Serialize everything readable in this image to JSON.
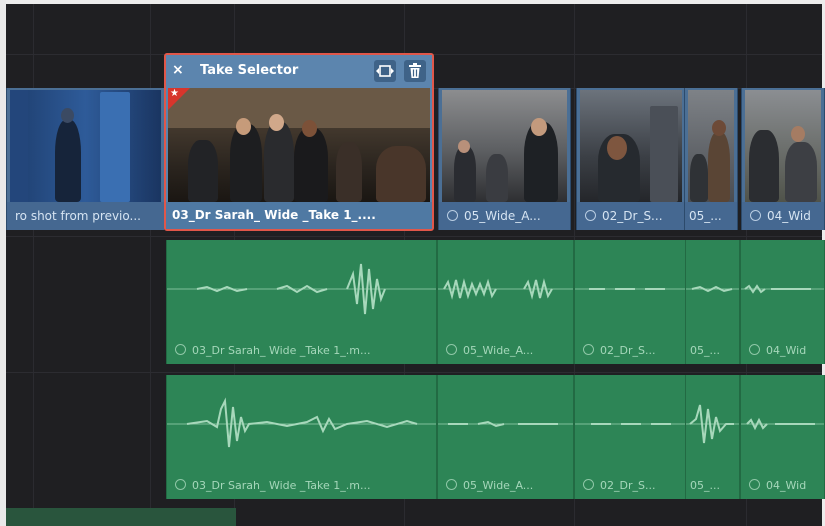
{
  "take_selector": {
    "close_label": "×",
    "title": "Take Selector",
    "clip_name": "03_Dr Sarah_ Wide _Take 1_...."
  },
  "video_track": [
    {
      "id": "prev",
      "label": "ro shot from previo...",
      "linked": false
    },
    {
      "id": "wide05",
      "label": "05_Wide_A...",
      "linked": true
    },
    {
      "id": "drs02",
      "label": "02_Dr_S...",
      "linked": true
    },
    {
      "id": "c05",
      "label": "05_...",
      "linked": false
    },
    {
      "id": "wid04",
      "label": "04_Wid",
      "linked": true
    }
  ],
  "audio_tracks": [
    {
      "clips": [
        {
          "label": "03_Dr Sarah_ Wide _Take 1_.m..."
        },
        {
          "label": "05_Wide_A..."
        },
        {
          "label": "02_Dr_S..."
        },
        {
          "label": "05_..."
        },
        {
          "label": "04_Wid"
        }
      ]
    },
    {
      "clips": [
        {
          "label": "03_Dr Sarah_ Wide _Take 1_.m..."
        },
        {
          "label": "05_Wide_A..."
        },
        {
          "label": "02_Dr_S..."
        },
        {
          "label": "05_..."
        },
        {
          "label": "04_Wid"
        }
      ]
    }
  ],
  "colors": {
    "video_clip": "#4b6f95",
    "audio_clip": "#2d8556",
    "take_border": "#e0574a",
    "flag": "#d7352c"
  },
  "icons": {
    "take_close": "close-icon",
    "take_fit": "fit-frame-icon",
    "take_delete": "trash-icon",
    "flag": "flag-icon",
    "link": "link-icon"
  }
}
